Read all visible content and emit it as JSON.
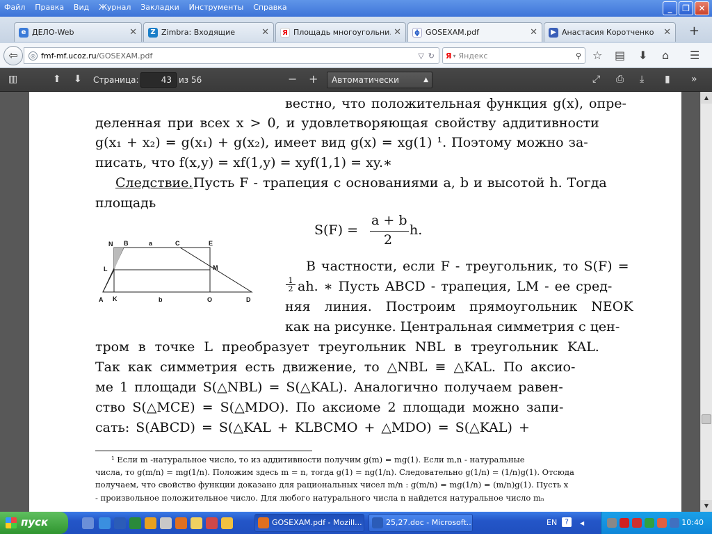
{
  "menu": {
    "items": [
      "Файл",
      "Правка",
      "Вид",
      "Журнал",
      "Закладки",
      "Инструменты",
      "Справка"
    ]
  },
  "window_controls": {
    "minimize": "_",
    "restore": "❐",
    "close": "✕"
  },
  "tabs": [
    {
      "label": "ДЕЛО-Web",
      "icon": "globe-icon"
    },
    {
      "label": "Zimbra: Входящие",
      "icon": "zimbra-icon"
    },
    {
      "label": "Площадь многоугольни...",
      "icon": "yandex-icon"
    },
    {
      "label": "GOSEXAM.pdf",
      "icon": "pdf-icon"
    },
    {
      "label": "Анастасия Коротченко",
      "icon": "video-icon"
    }
  ],
  "nav": {
    "url_host": "fmf-mf.",
    "url_domain": "ucoz.ru",
    "url_path": "/GOSEXAM.pdf",
    "search_brand": "Я",
    "search_placeholder": "Яндекс"
  },
  "pdf_toolbar": {
    "page_label": "Страница:",
    "page_value": "43",
    "page_total": "из 56",
    "zoom_value": "Автоматически"
  },
  "document": {
    "lines": [
      "вестно, что положительная функция g(x), опре-",
      "деленная при всех x > 0, и удовлетворяющая свойству аддитивности",
      "g(x₁ + x₂) = g(x₁) + g(x₂), имеет вид g(x) = xg(1) ¹. Поэтому можно за-",
      "писать, что f(x,y) = xf(1,y) = xyf(1,1) = xy.∗",
      "Следствие.",
      " Пусть F - трапеция с основаниями a, b и высотой h. Тогда",
      "площадь",
      "S(F) =",
      "a + b",
      "2",
      "h.",
      "В частности, если F - треугольник, то S(F) =",
      "ah. ∗ Пусть ABCD - трапеция, LM - ее сред-",
      "няя линия. Построим прямоугольник NEOK",
      "как на рисунке. Центральная симметрия с цен-",
      "тром в точке L преобразует треугольник NBL в треугольник KAL.",
      "Так как симметрия есть движение, то △NBL ≡ △KAL. По аксио-",
      "ме 1 площади S(△NBL) = S(△KAL). Аналогично получаем равен-",
      "ство S(△MCE) = S(△MDO). По аксиоме 2 площади можно запи-",
      "сать: S(ABCD) = S(△KAL + KLBCMO + △MDO) = S(△KAL) +"
    ],
    "half_num": "1",
    "half_den": "2",
    "figure_labels": [
      "N",
      "B",
      "a",
      "C",
      "E",
      "L",
      "M",
      "A",
      "K",
      "b",
      "O",
      "D"
    ],
    "footnote": [
      "¹ Если m -натуральное число, то из аддитивности получим g(m) = mg(1). Если m,n - натуральные",
      "числа, то g(m/n) = mg(1/n). Положим здесь m = n, тогда g(1) = ng(1/n). Следовательно g(1/n) = (1/n)g(1). Отсюда",
      "получаем, что свойство функции доказано для рациональных чисел m/n : g(m/n) = mg(1/n) = (m/n)g(1). Пусть x",
      "- произвольное положительное число. Для любого натурального числа n найдется натуральное число mₙ"
    ]
  },
  "taskbar": {
    "start_label": "пуск",
    "tasks": [
      "GOSEXAM.pdf - Mozill...",
      "25,27.doc - Microsoft..."
    ],
    "lang": "EN",
    "clock": "10:40"
  }
}
